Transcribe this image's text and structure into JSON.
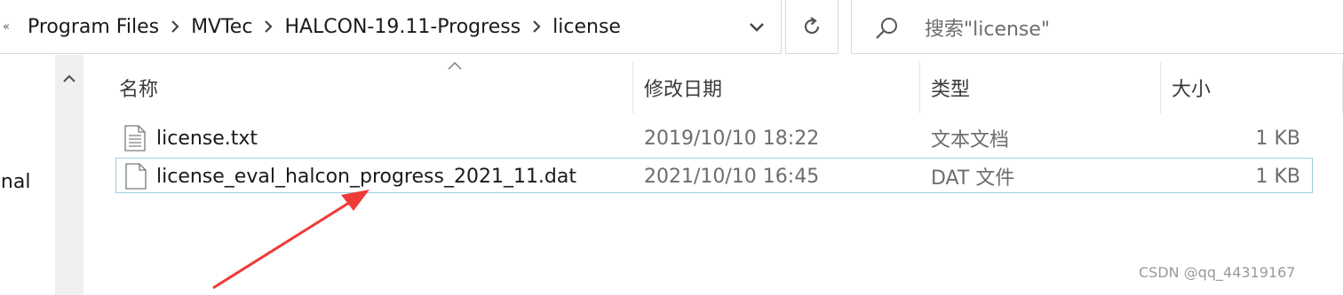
{
  "breadcrumb": {
    "overflow_glyph": "«",
    "segments": [
      "Program Files",
      "MVTec",
      "HALCON-19.11-Progress",
      "license"
    ]
  },
  "search": {
    "placeholder": "搜索\"license\""
  },
  "nav": {
    "partial_label": "sonal"
  },
  "columns": {
    "name": "名称",
    "date": "修改日期",
    "type": "类型",
    "size": "大小"
  },
  "files": [
    {
      "name": "license.txt",
      "date": "2019/10/10 18:22",
      "type": "文本文档",
      "size": "1 KB",
      "icon": "text-file-icon"
    },
    {
      "name": "license_eval_halcon_progress_2021_11.dat",
      "date": "2021/10/10 16:45",
      "type": "DAT 文件",
      "size": "1 KB",
      "icon": "blank-file-icon"
    }
  ],
  "watermark": "CSDN @qq_44319167",
  "colors": {
    "annotation_arrow": "#f03a3a",
    "hover_border": "#9ad0e0"
  }
}
